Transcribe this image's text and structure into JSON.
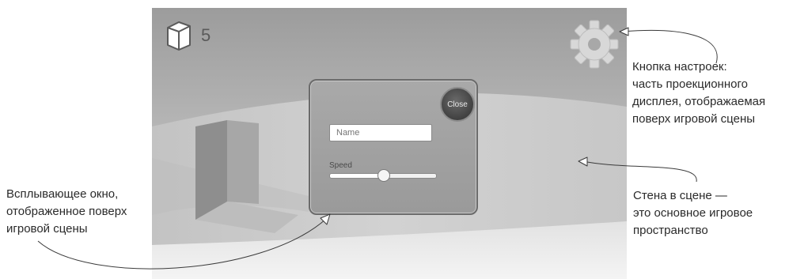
{
  "hud": {
    "cube_icon": "cube-icon",
    "cube_count": "5",
    "settings_icon": "gear-icon"
  },
  "popup": {
    "close_label": "Close",
    "name_placeholder": "Name",
    "speed_label": "Speed",
    "speed_value": 0.5
  },
  "annotations": {
    "settings": [
      "Кнопка настроек:",
      "часть проекционного",
      "дисплея, отображаемая",
      "поверх игровой сцены"
    ],
    "popup": [
      "Всплывающее окно,",
      "отображенное поверх",
      "игровой сцены"
    ],
    "wall": [
      "Стена в сцене —",
      "это основное игровое",
      "пространство"
    ]
  },
  "colors": {
    "sky": "#a4a4a4",
    "floor": "#ececec",
    "wall": "#cfcfcf",
    "pillar": "#9a9a9a",
    "popup_bg": "#a3a3a3",
    "close_button": "#4a4a4a"
  }
}
